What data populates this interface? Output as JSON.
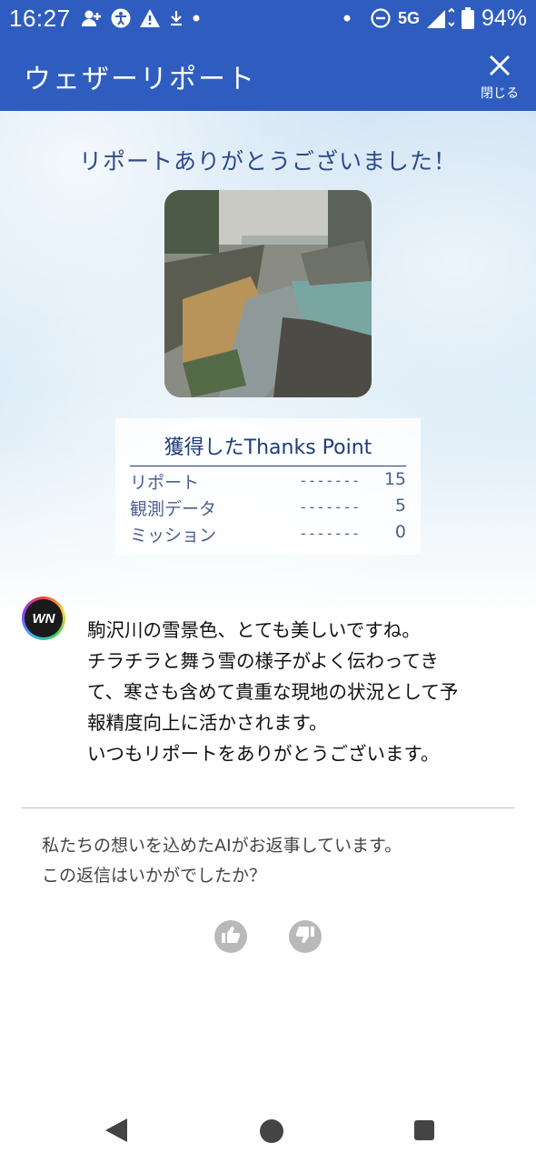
{
  "status_bar": {
    "time": "16:27",
    "network": "5G",
    "battery": "94%",
    "icons_left": [
      "person-add-icon",
      "accessibility-icon",
      "warning-icon",
      "download-icon",
      "dot-icon"
    ],
    "icons_right": [
      "dot-icon",
      "do-not-disturb-icon",
      "signal-icon",
      "battery-icon"
    ]
  },
  "header": {
    "title": "ウェザーリポート",
    "close_label": "閉じる",
    "background": "#2e5dbf"
  },
  "thanks": {
    "heading": "リポートありがとうございました！"
  },
  "points": {
    "title": "獲得したThanks Point",
    "rows": [
      {
        "label": "リポート",
        "dash": "-------",
        "value": "15"
      },
      {
        "label": "観測データ",
        "dash": "-------",
        "value": "5"
      },
      {
        "label": "ミッション",
        "dash": "-------",
        "value": "0"
      }
    ]
  },
  "ai_reply": {
    "avatar_text": "WN",
    "lines": [
      "駒沢川の雪景色、とても美しいですね。",
      "チラチラと舞う雪の様子がよく伝わってき",
      "て、寒さも含めて貴重な現地の状況として予",
      "報精度向上に活かされます。",
      "いつもリポートをありがとうございます。"
    ]
  },
  "feedback": {
    "lines": [
      "私たちの想いを込めたAIがお返事しています。",
      "この返信はいかがでしたか？"
    ],
    "buttons": [
      "thumbs-up-icon",
      "thumbs-down-icon"
    ]
  },
  "nav": {
    "buttons": [
      "back-icon",
      "home-icon",
      "recents-icon"
    ]
  }
}
